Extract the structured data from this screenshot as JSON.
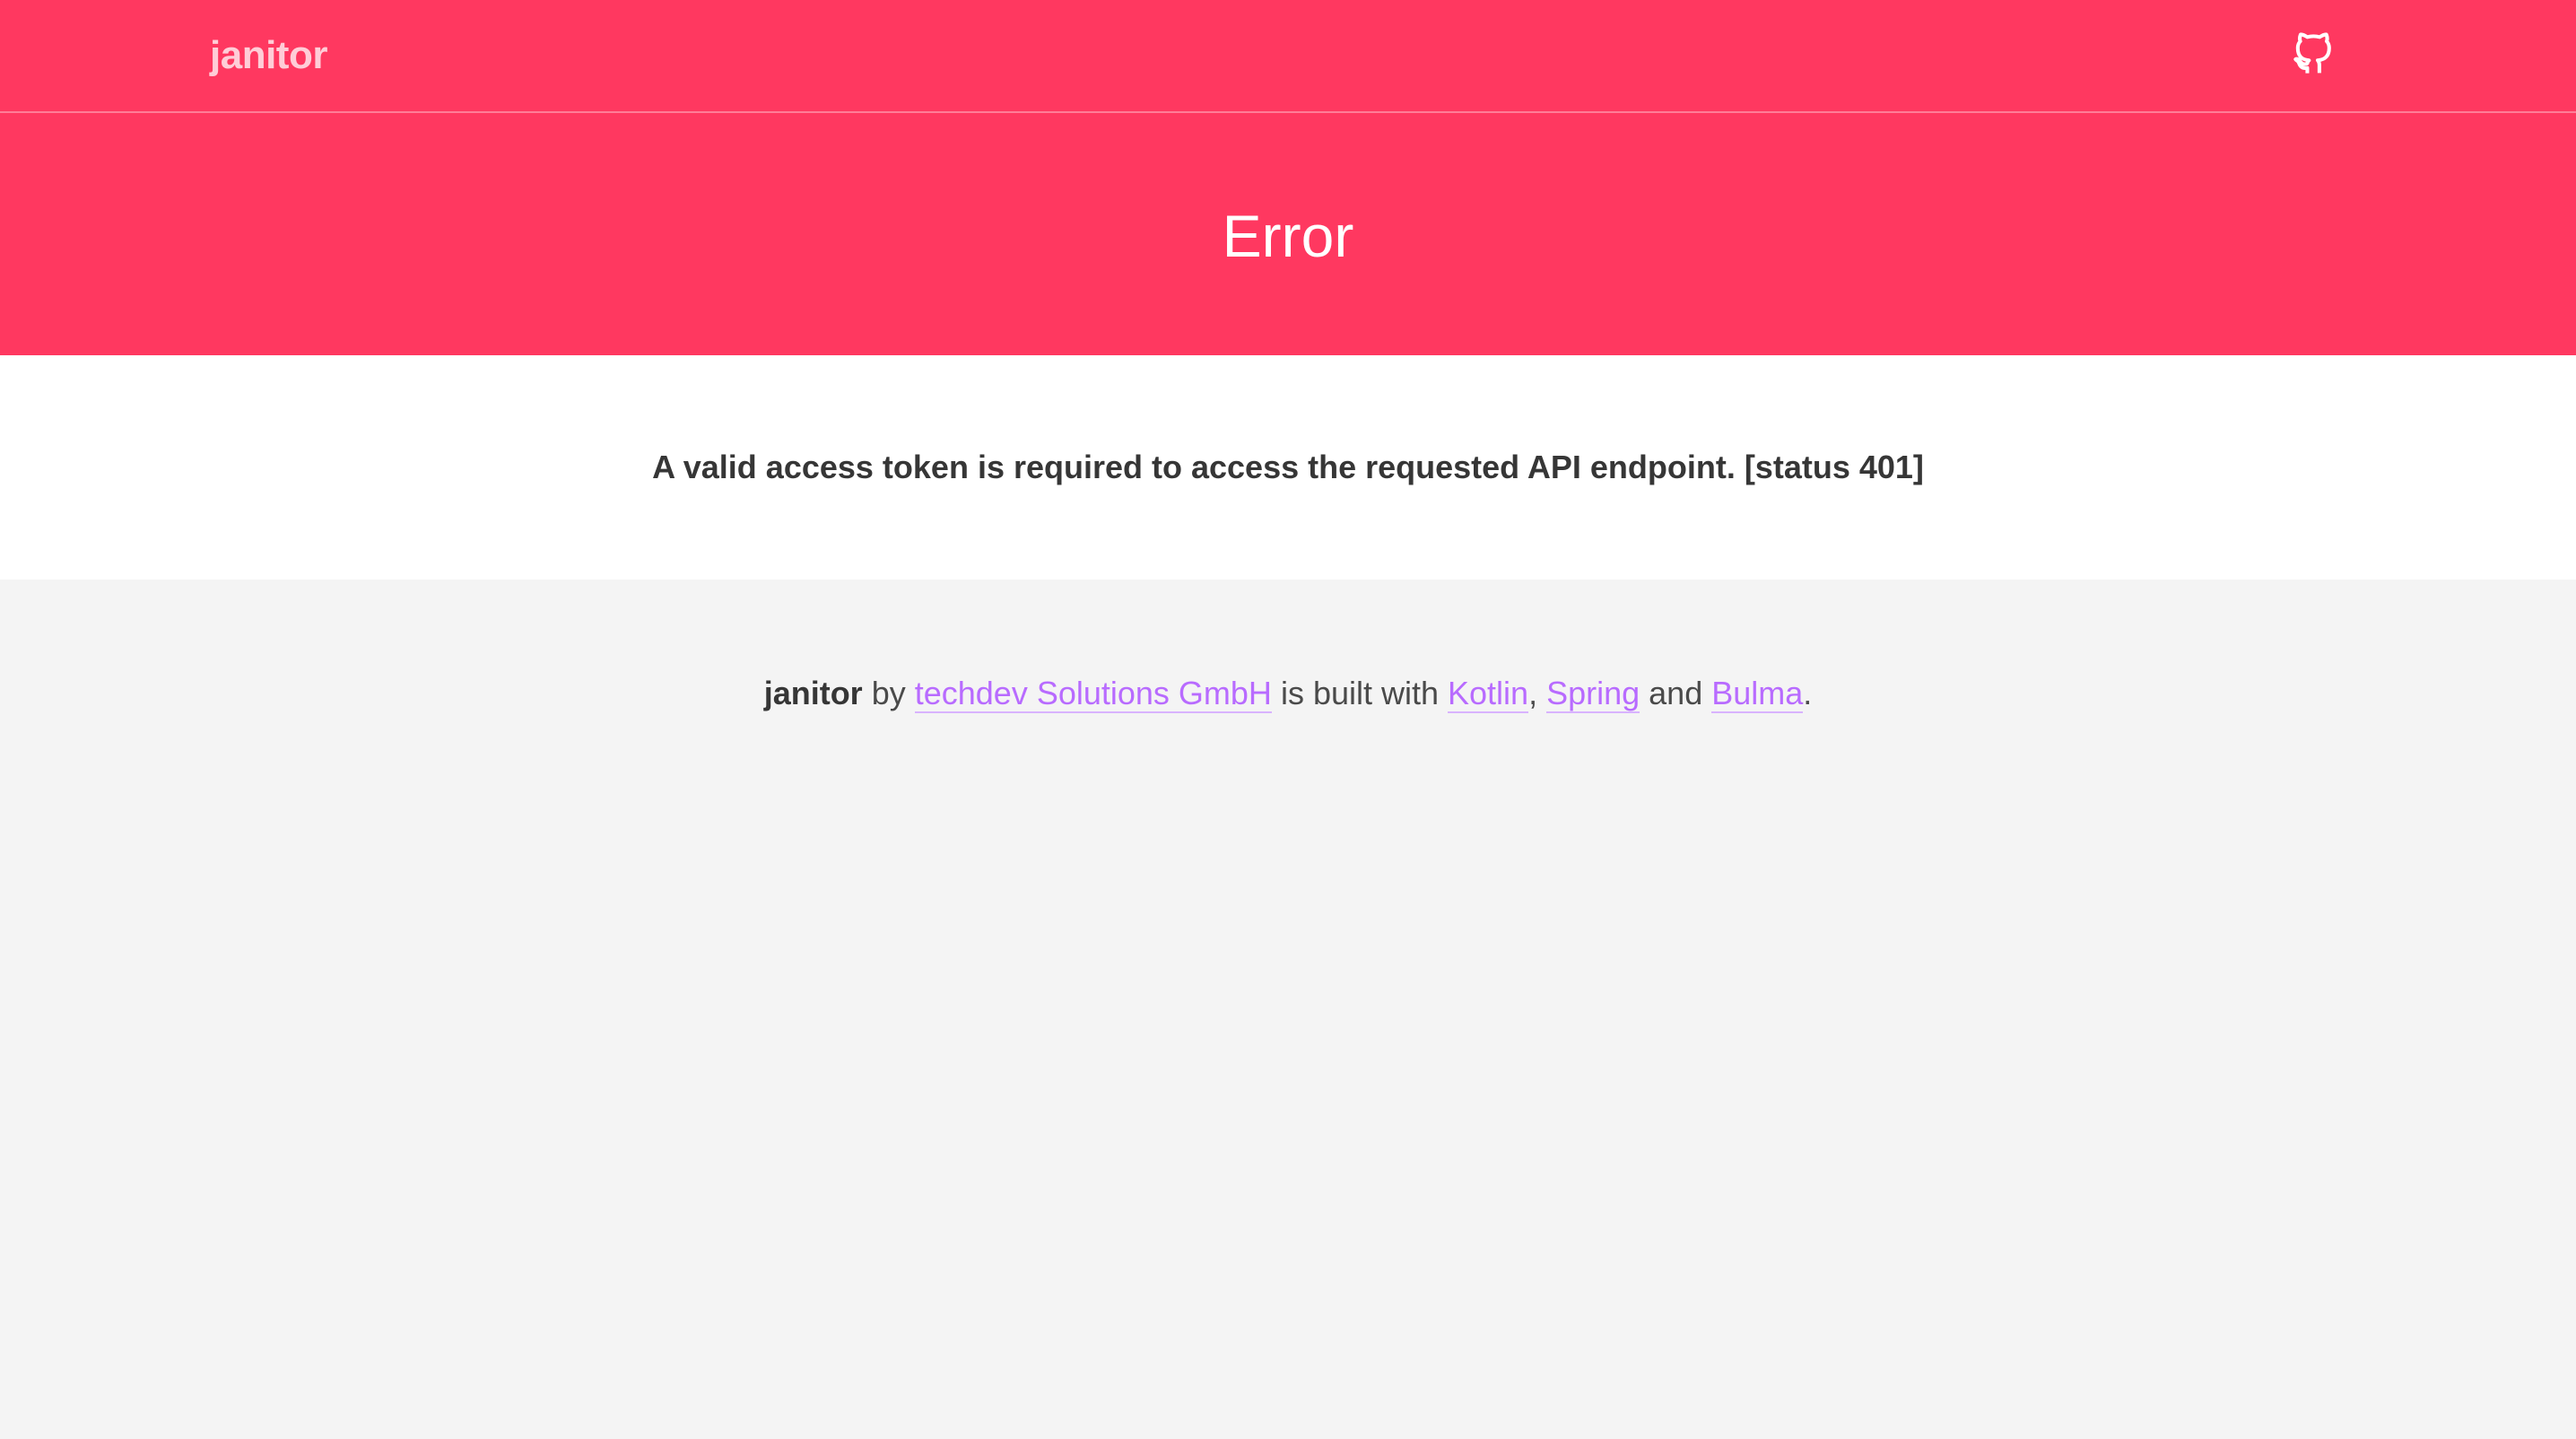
{
  "navbar": {
    "brand": "janitor",
    "github_icon": "github-icon"
  },
  "hero": {
    "title": "Error"
  },
  "message": {
    "text": "A valid access token is required to access the requested API endpoint. [status 401]"
  },
  "footer": {
    "brand": "janitor",
    "by": " by ",
    "company_link": "techdev Solutions GmbH",
    "built_with": " is built with ",
    "kotlin_link": "Kotlin",
    "sep1": ", ",
    "spring_link": "Spring",
    "and": " and ",
    "bulma_link": "Bulma",
    "period": "."
  },
  "colors": {
    "primary": "#ff3860",
    "link": "#b86bff",
    "text": "#363636",
    "footer_bg": "#f4f4f4"
  }
}
